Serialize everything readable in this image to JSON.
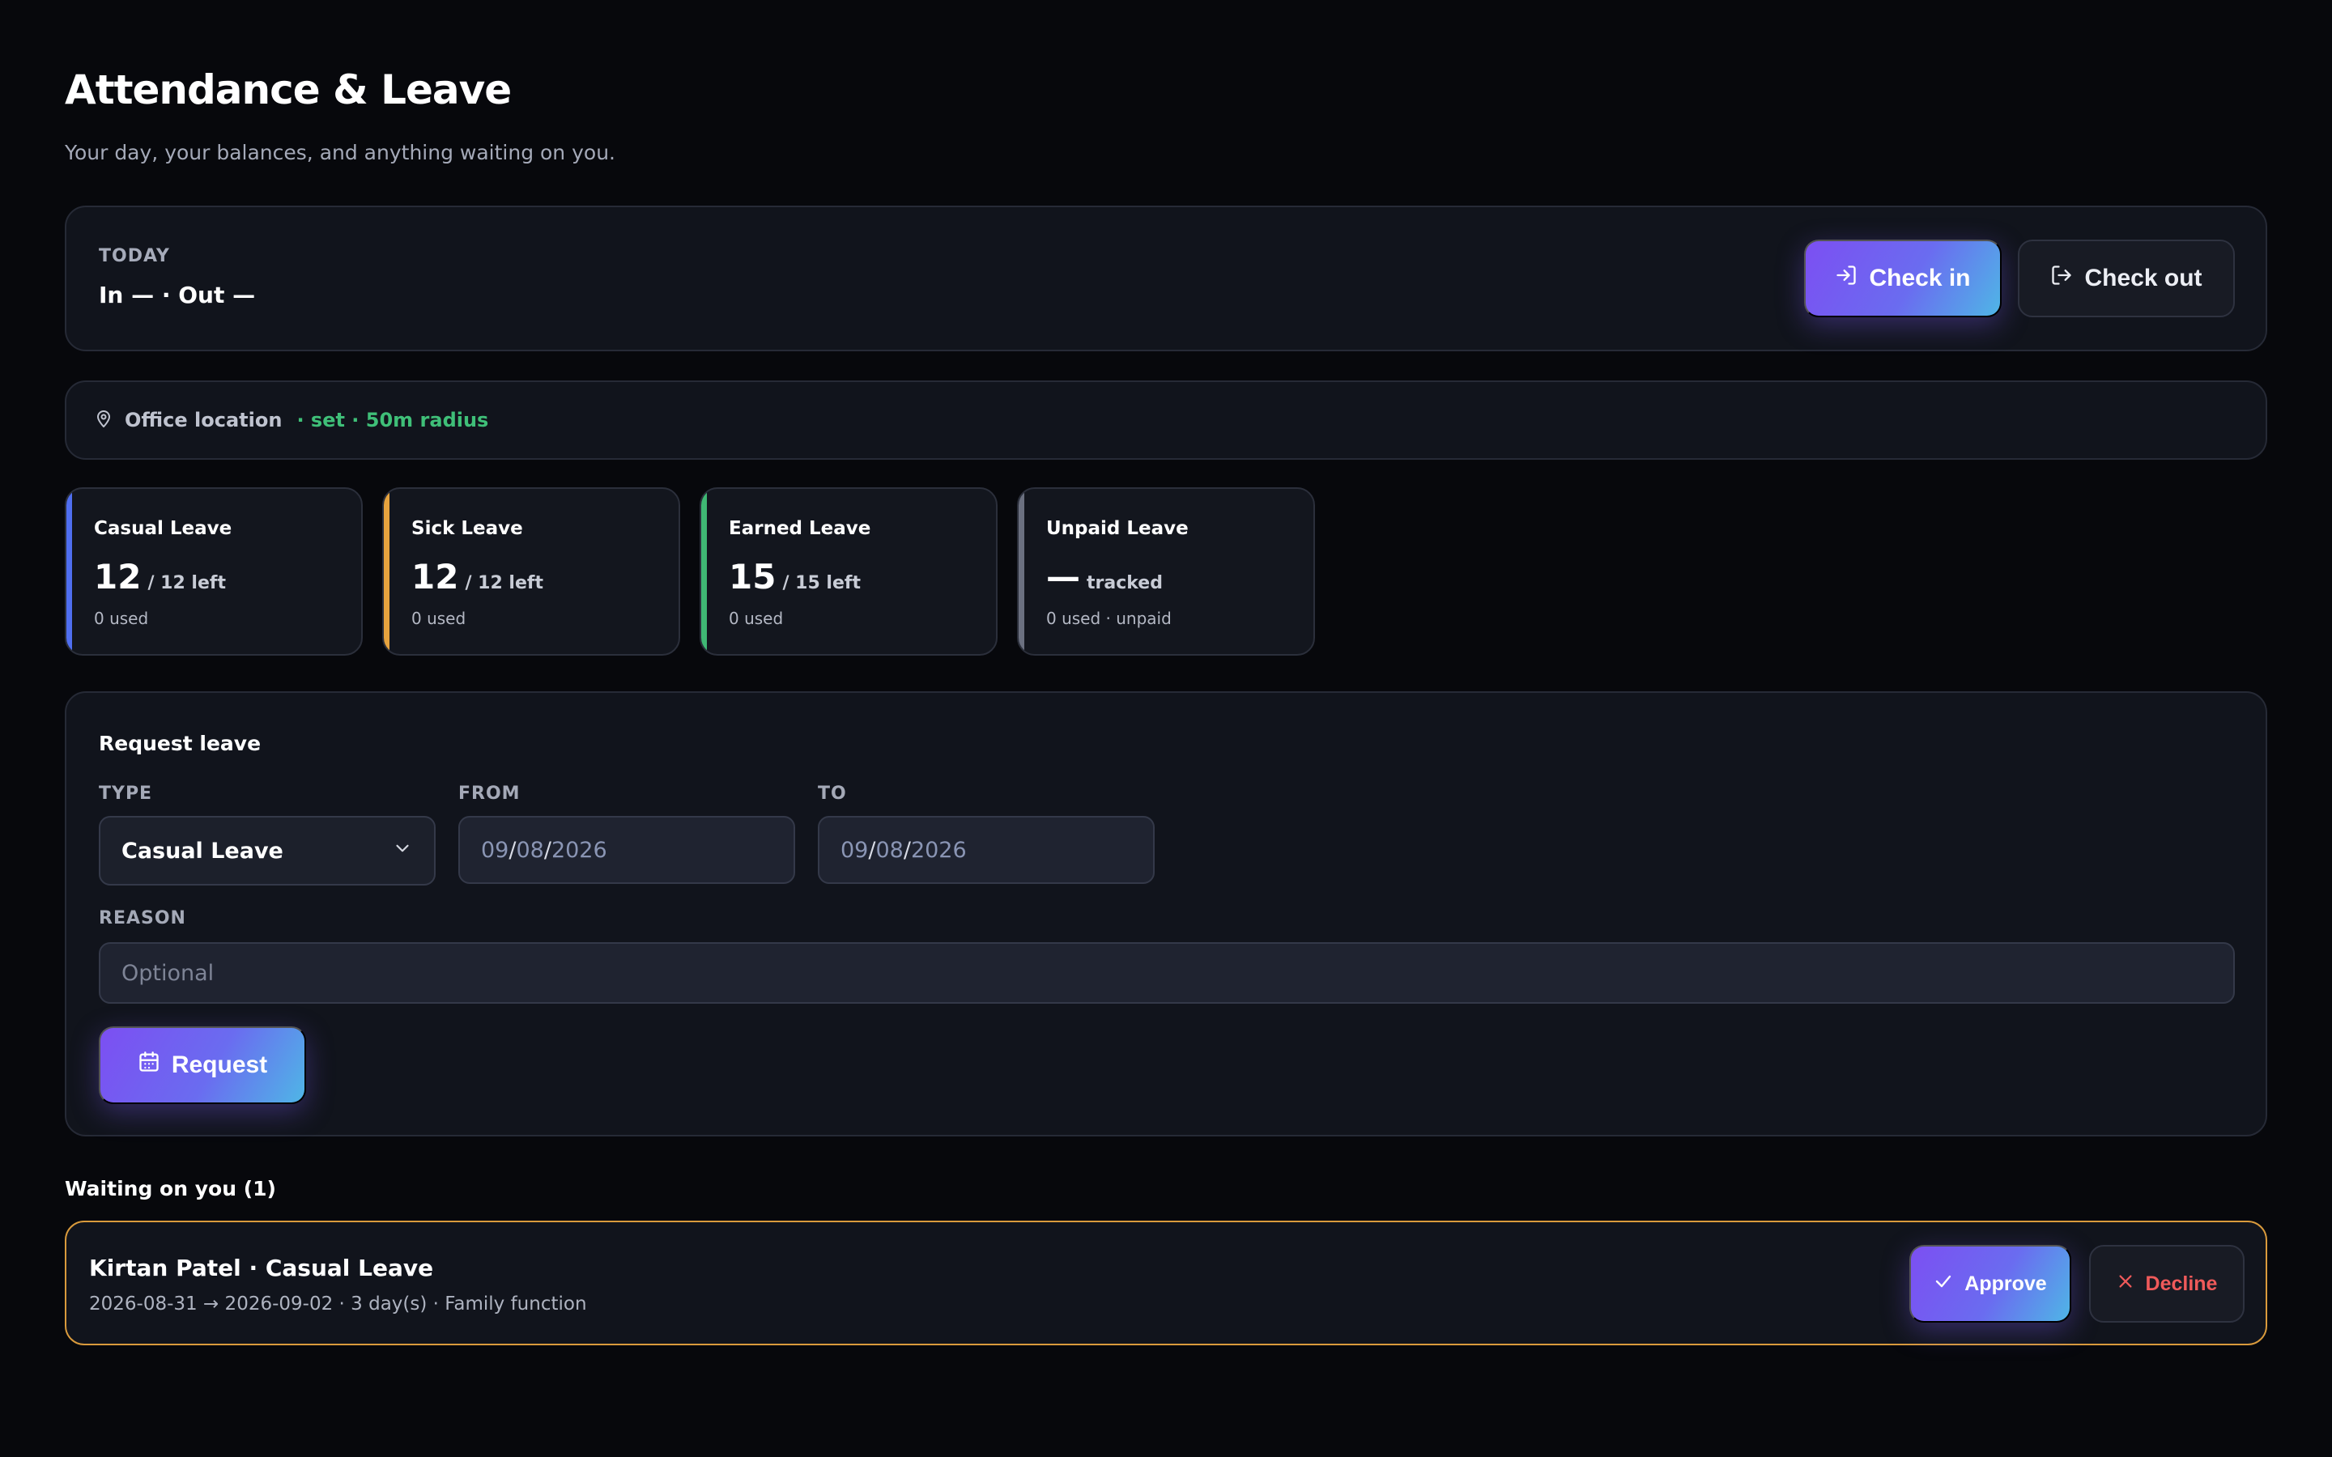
{
  "header": {
    "title": "Attendance & Leave",
    "subtitle": "Your day, your balances, and anything waiting on you."
  },
  "today": {
    "label": "TODAY",
    "status": "In — · Out —",
    "check_in_label": "Check in",
    "check_out_label": "Check out"
  },
  "location": {
    "label": "Office location",
    "status": "· set · 50m radius"
  },
  "leave_cards": [
    {
      "name": "Casual Leave",
      "value": "12",
      "left": "/ 12 left",
      "used": "0 used",
      "accent": "#4f6ef0"
    },
    {
      "name": "Sick Leave",
      "value": "12",
      "left": "/ 12 left",
      "used": "0 used",
      "accent": "#e6a33e"
    },
    {
      "name": "Earned Leave",
      "value": "15",
      "left": "/ 15 left",
      "used": "0 used",
      "accent": "#3fb874"
    },
    {
      "name": "Unpaid Leave",
      "value": "—",
      "left": "tracked",
      "used": "0 used · unpaid",
      "accent": "#6b7080"
    }
  ],
  "request_form": {
    "title": "Request leave",
    "type_label": "TYPE",
    "type_value": "Casual Leave",
    "from_label": "FROM",
    "from_date": {
      "mm": "09",
      "dd": "08",
      "yyyy": "2026",
      "sep": "/"
    },
    "to_label": "TO",
    "to_date": {
      "mm": "09",
      "dd": "08",
      "yyyy": "2026",
      "sep": "/"
    },
    "reason_label": "REASON",
    "reason_placeholder": "Optional",
    "submit_label": "Request"
  },
  "waiting": {
    "title": "Waiting on you (1)",
    "items": [
      {
        "who": "Kirtan Patel · Casual Leave",
        "detail": "2026-08-31 → 2026-09-02 · 3 day(s) · Family function",
        "approve_label": "Approve",
        "decline_label": "Decline"
      }
    ]
  },
  "colors": {
    "background": "#07080c",
    "panel": "#11141c",
    "success": "#3fbf78",
    "warning_border": "#d99a3c",
    "danger": "#ef5a5a",
    "accent_gradient_start": "#7c4ff2",
    "accent_gradient_end": "#4fb6e6"
  },
  "icons": {
    "check_in": "login-icon",
    "check_out": "logout-icon",
    "location": "map-pin-icon",
    "dropdown": "chevron-down-icon",
    "request": "calendar-icon",
    "approve": "check-icon",
    "decline": "close-icon"
  }
}
